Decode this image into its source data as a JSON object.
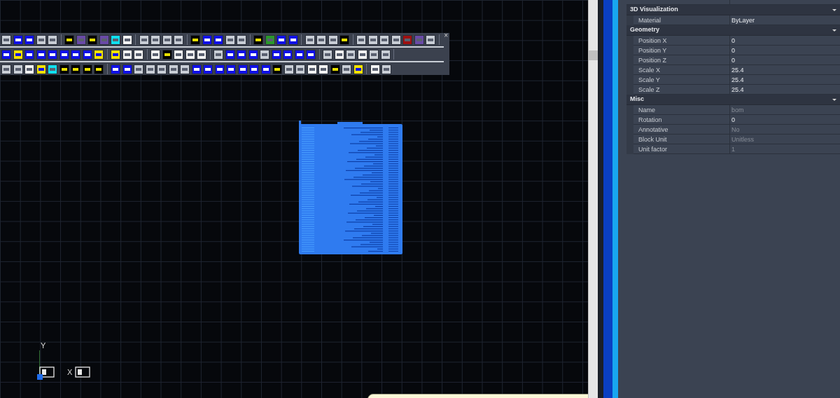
{
  "toolbar": {
    "close": "×"
  },
  "ucs": {
    "y_label": "Y",
    "x_label": "X"
  },
  "properties": {
    "categories": [
      {
        "title": "3D Visualization",
        "expanded": true,
        "rows": [
          {
            "label": "Material",
            "value": "ByLayer",
            "disabled": false
          }
        ]
      },
      {
        "title": "Geometry",
        "expanded": true,
        "rows": [
          {
            "label": "Position X",
            "value": "0",
            "disabled": false
          },
          {
            "label": "Position Y",
            "value": "0",
            "disabled": false
          },
          {
            "label": "Position Z",
            "value": "0",
            "disabled": false
          },
          {
            "label": "Scale X",
            "value": "25.4",
            "disabled": false
          },
          {
            "label": "Scale Y",
            "value": "25.4",
            "disabled": false
          },
          {
            "label": "Scale Z",
            "value": "25.4",
            "disabled": false
          }
        ]
      },
      {
        "title": "Misc",
        "expanded": true,
        "rows": [
          {
            "label": "Name",
            "value": "bom",
            "disabled": true
          },
          {
            "label": "Rotation",
            "value": "0",
            "disabled": false
          },
          {
            "label": "Annotative",
            "value": "No",
            "disabled": true
          },
          {
            "label": "Block Unit",
            "value": "Unitless",
            "disabled": true
          },
          {
            "label": "Unit factor",
            "value": "1",
            "disabled": true
          }
        ]
      }
    ]
  }
}
